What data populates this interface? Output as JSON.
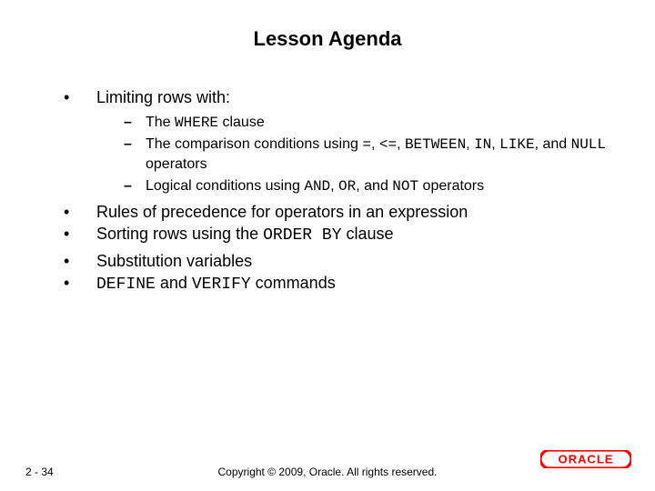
{
  "title": "Lesson Agenda",
  "bullets": {
    "b1": "Limiting rows with:",
    "b1_sub": {
      "s1_pre": "The ",
      "s1_code": "WHERE",
      "s1_post": " clause",
      "s2_pre": "The comparison conditions using ",
      "s2_c1": "=",
      "s2_m1": ", ",
      "s2_c2": "<=",
      "s2_m2": ", ",
      "s2_c3": "BETWEEN",
      "s2_m3": ", ",
      "s2_c4": "IN",
      "s2_m4": ", ",
      "s2_c5": "LIKE",
      "s2_m5": ", and ",
      "s2_c6": "NULL",
      "s2_post": " operators",
      "s3_pre": "Logical conditions using ",
      "s3_c1": "AND",
      "s3_m1": ", ",
      "s3_c2": "OR",
      "s3_m2": ", and ",
      "s3_c3": "NOT",
      "s3_post": " operators"
    },
    "b2": "Rules of precedence for operators in an expression",
    "b3_pre": "Sorting rows using the ",
    "b3_code": "ORDER BY",
    "b3_post": " clause",
    "b4": "Substitution variables",
    "b5_c1": "DEFINE",
    "b5_m1": " and ",
    "b5_c2": "VERIFY",
    "b5_post": " commands"
  },
  "footer": {
    "page": "2 - 34",
    "copyright": "Copyright © 2009, Oracle. All rights reserved."
  },
  "logo": {
    "brand": "ORACLE",
    "color": "#ff0000"
  }
}
